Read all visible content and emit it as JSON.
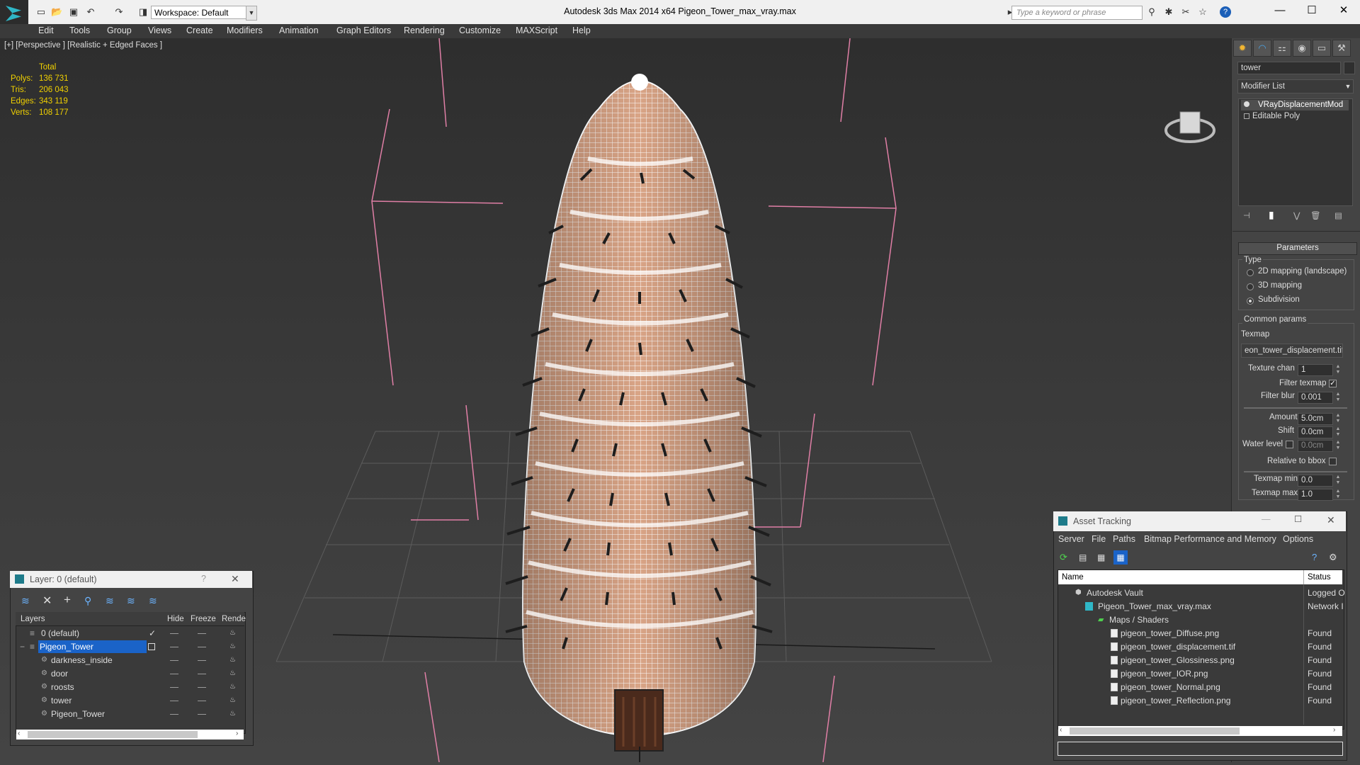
{
  "titlebar": {
    "app_title": "Autodesk 3ds Max  2014 x64     Pigeon_Tower_max_vray.max",
    "workspace": "Workspace: Default",
    "search_placeholder": "Type a keyword or phrase"
  },
  "menu": [
    "Edit",
    "Tools",
    "Group",
    "Views",
    "Create",
    "Modifiers",
    "Animation",
    "Graph Editors",
    "Rendering",
    "Customize",
    "MAXScript",
    "Help"
  ],
  "viewport": {
    "label": "[+] [Perspective ] [Realistic + Edged Faces ]",
    "stats_header": "Total",
    "stats": [
      {
        "label": "Polys:",
        "value": "136 731"
      },
      {
        "label": "Tris:",
        "value": "206 043"
      },
      {
        "label": "Edges:",
        "value": "343 119"
      },
      {
        "label": "Verts:",
        "value": "108 177"
      }
    ]
  },
  "command_panel": {
    "object_name": "tower",
    "modifier_list": "Modifier List",
    "stack": [
      "VRayDisplacementMod",
      "Editable Poly"
    ],
    "rollout": "Parameters",
    "type_group": "Type",
    "types": [
      "2D mapping (landscape)",
      "3D mapping",
      "Subdivision"
    ],
    "selected_type": "Subdivision",
    "common_group": "Common params",
    "texmap_label": "Texmap",
    "texmap_value": "eon_tower_displacement.tif)",
    "texture_chan_label": "Texture chan",
    "texture_chan_value": "1",
    "filter_texmap_label": "Filter texmap",
    "filter_texmap_checked": true,
    "filter_blur_label": "Filter blur",
    "filter_blur_value": "0.001",
    "amount_label": "Amount",
    "amount_value": "5.0cm",
    "shift_label": "Shift",
    "shift_value": "0.0cm",
    "water_level_label": "Water level",
    "water_level_value": "0.0cm",
    "relative_bbox_label": "Relative to bbox",
    "texmap_min_label": "Texmap min",
    "texmap_min_value": "0.0",
    "texmap_max_label": "Texmap max",
    "texmap_max_value": "1.0"
  },
  "layer_dialog": {
    "title": "Layer: 0 (default)",
    "help": "?",
    "columns": [
      "Layers",
      "Hide",
      "Freeze",
      "Rende"
    ],
    "rows": [
      {
        "name": "0 (default)",
        "indent": 0,
        "active": true
      },
      {
        "name": "Pigeon_Tower",
        "indent": 0,
        "selected": true
      },
      {
        "name": "darkness_inside",
        "indent": 1
      },
      {
        "name": "door",
        "indent": 1
      },
      {
        "name": "roosts",
        "indent": 1
      },
      {
        "name": "tower",
        "indent": 1
      },
      {
        "name": "Pigeon_Tower",
        "indent": 1
      }
    ]
  },
  "asset_tracking": {
    "title": "Asset Tracking",
    "menu": [
      "Server",
      "File",
      "Paths",
      "Bitmap Performance and Memory",
      "Options"
    ],
    "columns": [
      "Name",
      "Status"
    ],
    "rows": [
      {
        "name": "Autodesk Vault",
        "status": "Logged O",
        "indent": 0
      },
      {
        "name": "Pigeon_Tower_max_vray.max",
        "status": "Network I",
        "indent": 1
      },
      {
        "name": "Maps / Shaders",
        "status": "",
        "indent": 2
      },
      {
        "name": "pigeon_tower_Diffuse.png",
        "status": "Found",
        "indent": 3
      },
      {
        "name": "pigeon_tower_displacement.tif",
        "status": "Found",
        "indent": 3
      },
      {
        "name": "pigeon_tower_Glossiness.png",
        "status": "Found",
        "indent": 3
      },
      {
        "name": "pigeon_tower_IOR.png",
        "status": "Found",
        "indent": 3
      },
      {
        "name": "pigeon_tower_Normal.png",
        "status": "Found",
        "indent": 3
      },
      {
        "name": "pigeon_tower_Reflection.png",
        "status": "Found",
        "indent": 3
      }
    ]
  }
}
